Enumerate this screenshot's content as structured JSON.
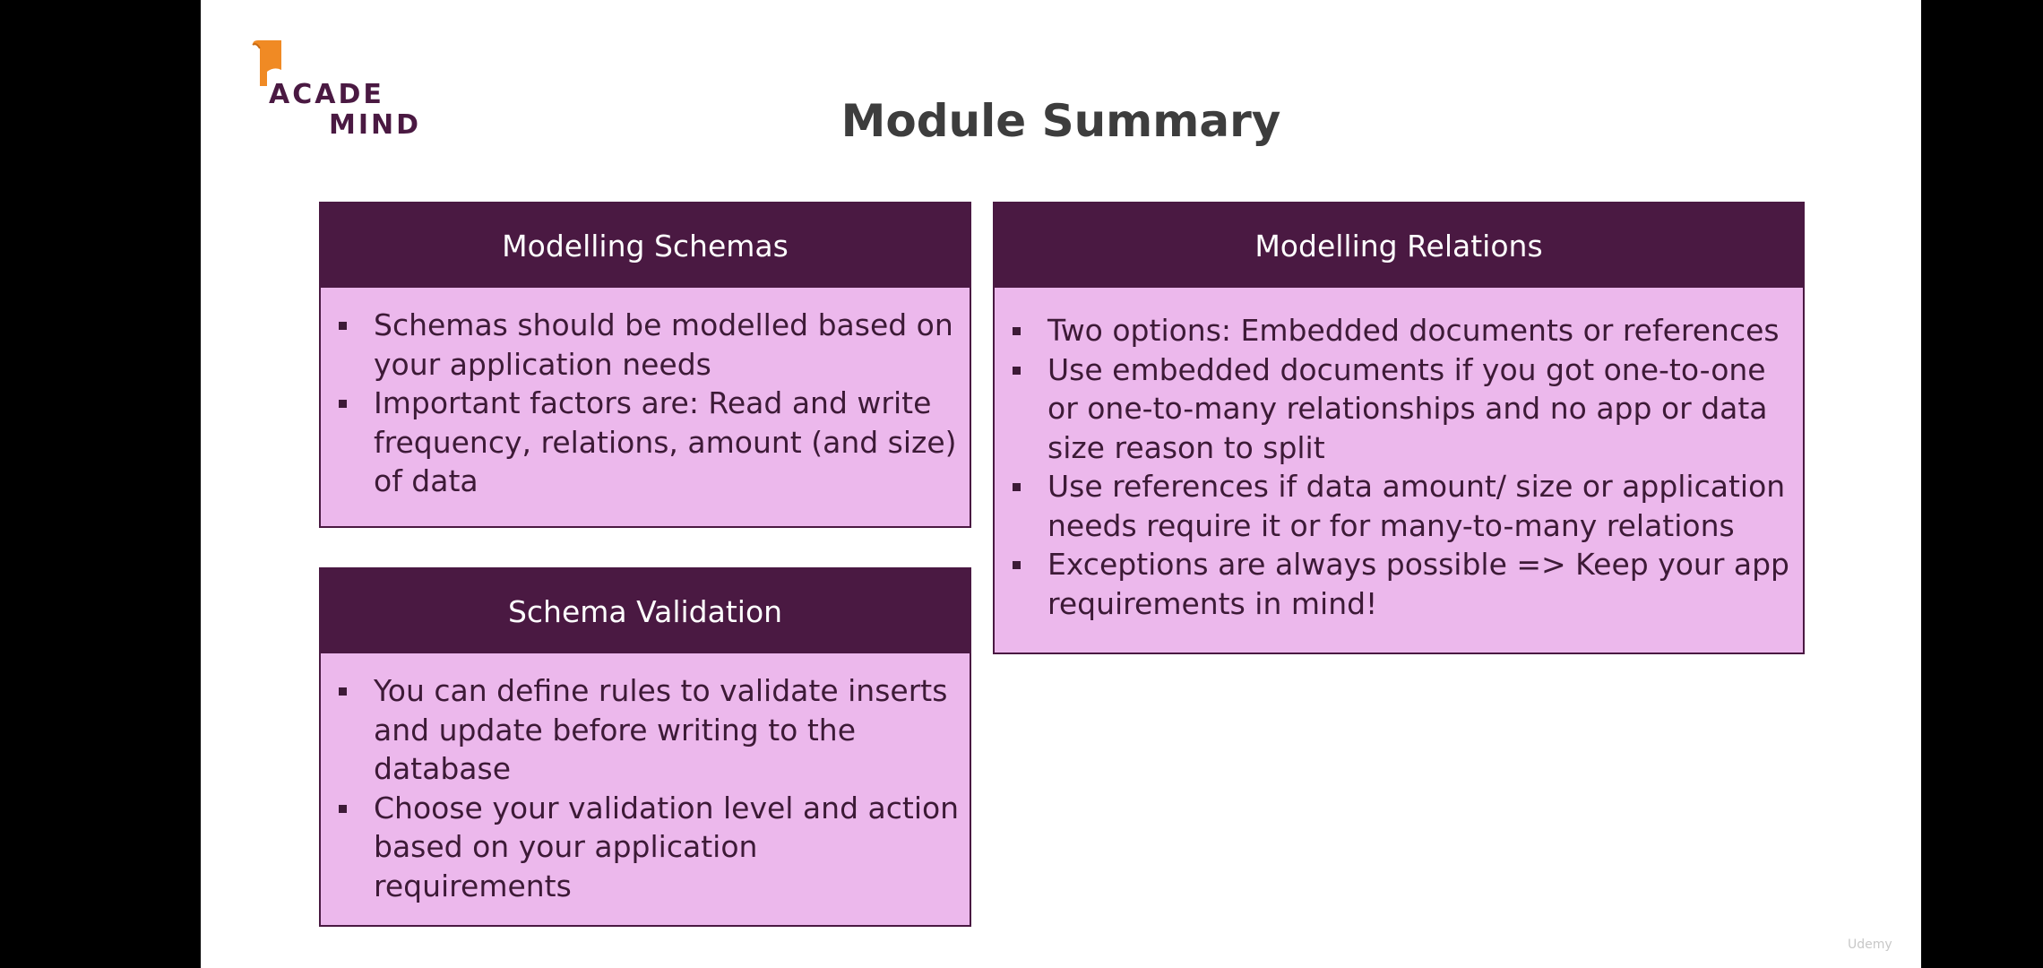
{
  "logo": {
    "line1": "ACADE",
    "line2": "MIND",
    "brand_color": "#4a1942",
    "accent_color": "#f08a24"
  },
  "title": "Module Summary",
  "colors": {
    "header_bg": "#4a1942",
    "card_bg": "#ecb8ec",
    "text": "#3d1a37",
    "title": "#3d3d3d"
  },
  "cards": {
    "schemas": {
      "heading": "Modelling Schemas",
      "items": [
        "Schemas should be modelled based on your application needs",
        "Important factors are: Read and write frequency, relations, amount (and size) of data"
      ]
    },
    "validation": {
      "heading": "Schema Validation",
      "items": [
        "You can define rules to validate inserts and update before writing to the database",
        "Choose your validation level and action based on your application requirements"
      ]
    },
    "relations": {
      "heading": "Modelling Relations",
      "items": [
        "Two options: Embedded documents or references",
        "Use embedded documents if you got one-to-one or one-to-many relationships and no app or data size reason to split",
        "Use references if data amount/ size or application needs require it or for many-to-many relations",
        "Exceptions are always possible => Keep your app requirements in mind!"
      ]
    }
  },
  "watermark": "Udemy"
}
